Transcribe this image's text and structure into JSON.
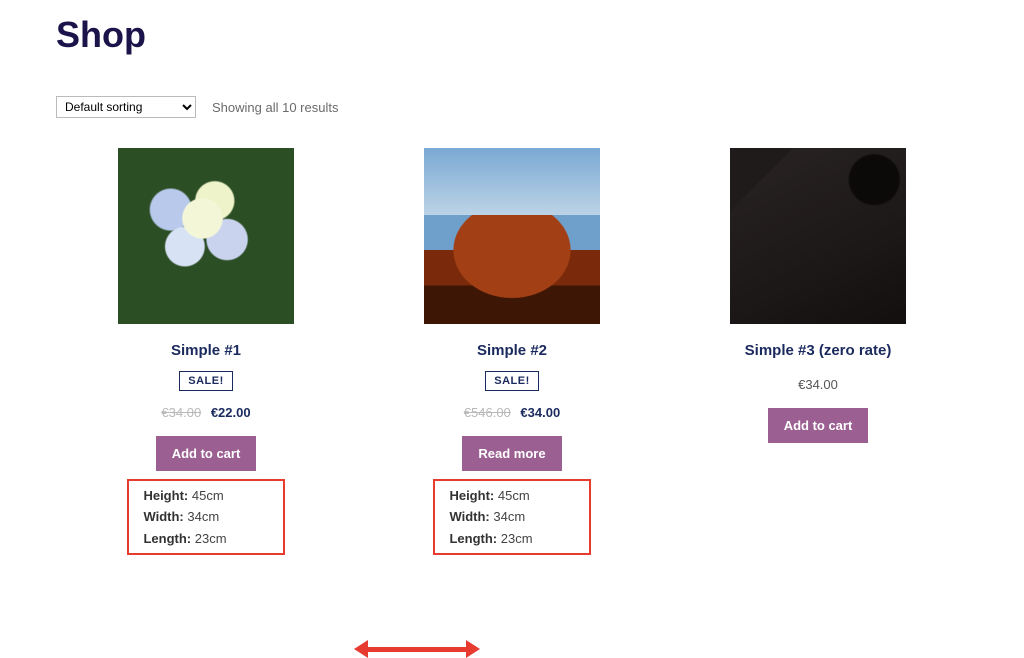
{
  "page": {
    "title": "Shop"
  },
  "toolbar": {
    "sort_value": "Default sorting",
    "result_count": "Showing all 10 results"
  },
  "sale_badge": "SALE!",
  "products": [
    {
      "title": "Simple #1",
      "on_sale": true,
      "old_price": "€34.00",
      "price": "€22.00",
      "cta": "Add to cart",
      "dims": {
        "height_label": "Height:",
        "height": "45cm",
        "width_label": "Width:",
        "width": "34cm",
        "length_label": "Length:",
        "length": "23cm"
      }
    },
    {
      "title": "Simple #2",
      "on_sale": true,
      "old_price": "€546.00",
      "price": "€34.00",
      "cta": "Read more",
      "dims": {
        "height_label": "Height:",
        "height": "45cm",
        "width_label": "Width:",
        "width": "34cm",
        "length_label": "Length:",
        "length": "23cm"
      }
    },
    {
      "title": "Simple #3 (zero rate)",
      "on_sale": false,
      "old_price": "",
      "price": "€34.00",
      "cta": "Add to cart",
      "dims": null
    }
  ]
}
